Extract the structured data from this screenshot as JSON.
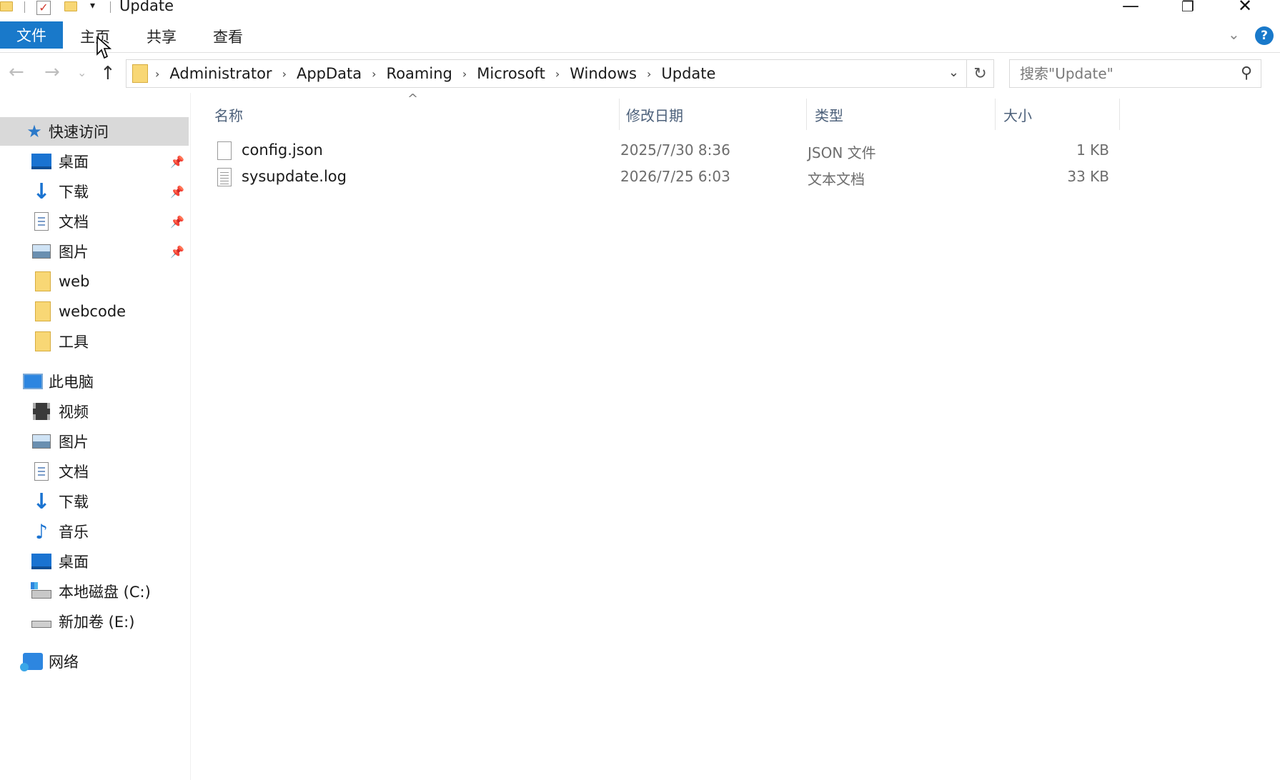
{
  "window": {
    "title": "Update",
    "qat_dropdown": "▾",
    "minimize": "—",
    "restore": "❐",
    "close": "✕"
  },
  "ribbon": {
    "tabs": [
      {
        "label": "文件",
        "active": true
      },
      {
        "label": "主页"
      },
      {
        "label": "共享"
      },
      {
        "label": "查看"
      }
    ],
    "chevron": "⌄",
    "help": "?"
  },
  "nav": {
    "back": "←",
    "forward": "→",
    "recent": "⌄",
    "up": "↑",
    "breadcrumb": [
      "Administrator",
      "AppData",
      "Roaming",
      "Microsoft",
      "Windows",
      "Update"
    ],
    "crumb_separator": "›",
    "dropdown": "⌄",
    "refresh": "↻",
    "search_placeholder": "搜索\"Update\"",
    "search_glyph": "⚲"
  },
  "sidebar": {
    "pin_glyph": "📌",
    "items": [
      {
        "label": "快速访问",
        "icon": "star-icon",
        "selected": true
      },
      {
        "label": "桌面",
        "icon": "desktop-icon",
        "pinned": true
      },
      {
        "label": "下载",
        "icon": "download-icon",
        "pinned": true
      },
      {
        "label": "文档",
        "icon": "document-icon",
        "pinned": true
      },
      {
        "label": "图片",
        "icon": "picture-icon",
        "pinned": true
      },
      {
        "label": "web",
        "icon": "folder-icon"
      },
      {
        "label": "webcode",
        "icon": "folder-icon"
      },
      {
        "label": "工具",
        "icon": "folder-icon"
      },
      {
        "label": "此电脑",
        "icon": "computer-icon"
      },
      {
        "label": "视频",
        "icon": "video-icon"
      },
      {
        "label": "图片",
        "icon": "picture-icon"
      },
      {
        "label": "文档",
        "icon": "document-icon"
      },
      {
        "label": "下载",
        "icon": "download-icon"
      },
      {
        "label": "音乐",
        "icon": "music-icon"
      },
      {
        "label": "桌面",
        "icon": "desktop-icon"
      },
      {
        "label": "本地磁盘 (C:)",
        "icon": "local-disk-icon"
      },
      {
        "label": "新加卷 (E:)",
        "icon": "drive-icon"
      },
      {
        "label": "网络",
        "icon": "network-icon"
      }
    ]
  },
  "files": {
    "sort_indicator": "^",
    "columns": [
      "名称",
      "修改日期",
      "类型",
      "大小"
    ],
    "rows": [
      {
        "name": "config.json",
        "date": "2025/7/30 8:36",
        "type": "JSON 文件",
        "size": "1 KB",
        "icon": "blank-file-icon"
      },
      {
        "name": "sysupdate.log",
        "date": "2026/7/25 6:03",
        "type": "文本文档",
        "size": "33 KB",
        "icon": "text-file-icon"
      }
    ]
  },
  "colors": {
    "accent": "#1979ca",
    "folder": "#f8d775",
    "selection": "#d9d9d9",
    "header_text": "#4c607a"
  }
}
